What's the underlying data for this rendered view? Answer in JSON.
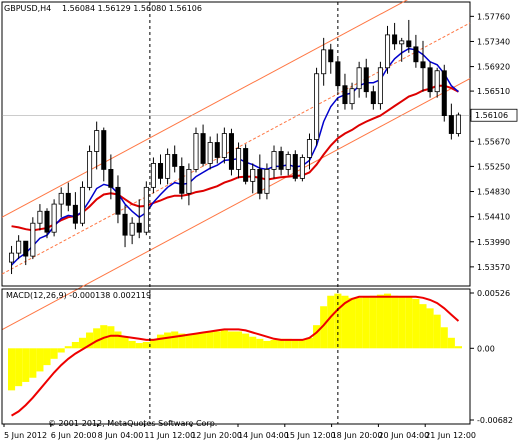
{
  "header": {
    "symbol": "GBPUSD,H4",
    "ohlc": "1.56084 1.56129 1.56080 1.56106"
  },
  "macd_header": "MACD(12,26,9) -0.000138 0.002119",
  "copyright": "© 2001-2012, MetaQuotes Software Corp.",
  "colors": {
    "bull_candle": "#ffffff",
    "bear_candle": "#000000",
    "fast_ma": "#0000cc",
    "slow_ma": "#dd0000",
    "channel": "#ff7744",
    "macd_hist": "#ffff00",
    "macd_signal": "#ee0000"
  },
  "chart_data": [
    {
      "type": "candlestick",
      "title": "GBPUSD,H4",
      "current_price": 1.56106,
      "y_ticks": [
        "1.57760",
        "1.57340",
        "1.56920",
        "1.56510",
        "1.56090",
        "1.55670",
        "1.55250",
        "1.54830",
        "1.54410",
        "1.53990",
        "1.53570"
      ],
      "ylim": [
        1.5325,
        1.58
      ],
      "x_labels": [
        "5 Jun 2012",
        "6 Jun 20:00",
        "8 Jun 04:00",
        "11 Jun 12:00",
        "12 Jun 20:00",
        "14 Jun 04:00",
        "15 Jun 12:00",
        "18 Jun 20:00",
        "20 Jun 04:00",
        "21 Jun 12:00"
      ],
      "candles": [
        [
          1.5365,
          1.5392,
          1.5345,
          1.538
        ],
        [
          1.538,
          1.541,
          1.537,
          1.54
        ],
        [
          1.54,
          1.5395,
          1.536,
          1.5375
        ],
        [
          1.5375,
          1.544,
          1.537,
          1.543
        ],
        [
          1.543,
          1.5462,
          1.5418,
          1.545
        ],
        [
          1.545,
          1.5455,
          1.5405,
          1.5415
        ],
        [
          1.5415,
          1.547,
          1.5408,
          1.5462
        ],
        [
          1.5462,
          1.549,
          1.544,
          1.548
        ],
        [
          1.548,
          1.5498,
          1.545,
          1.546
        ],
        [
          1.546,
          1.5482,
          1.542,
          1.543
        ],
        [
          1.543,
          1.55,
          1.5425,
          1.549
        ],
        [
          1.549,
          1.556,
          1.5485,
          1.555
        ],
        [
          1.555,
          1.56,
          1.552,
          1.5585
        ],
        [
          1.5585,
          1.559,
          1.55,
          1.552
        ],
        [
          1.552,
          1.5545,
          1.547,
          1.549
        ],
        [
          1.549,
          1.551,
          1.543,
          1.5445
        ],
        [
          1.5445,
          1.546,
          1.539,
          1.541
        ],
        [
          1.541,
          1.544,
          1.5395,
          1.543
        ],
        [
          1.543,
          1.547,
          1.5405,
          1.5415
        ],
        [
          1.5415,
          1.55,
          1.541,
          1.549
        ],
        [
          1.549,
          1.554,
          1.548,
          1.553
        ],
        [
          1.553,
          1.5545,
          1.5495,
          1.5505
        ],
        [
          1.5505,
          1.5555,
          1.5495,
          1.5545
        ],
        [
          1.5545,
          1.556,
          1.5515,
          1.5525
        ],
        [
          1.5525,
          1.554,
          1.547,
          1.548
        ],
        [
          1.548,
          1.553,
          1.546,
          1.552
        ],
        [
          1.552,
          1.559,
          1.5515,
          1.558
        ],
        [
          1.558,
          1.5595,
          1.5525,
          1.553
        ],
        [
          1.553,
          1.5575,
          1.552,
          1.5565
        ],
        [
          1.5565,
          1.558,
          1.553,
          1.554
        ],
        [
          1.554,
          1.559,
          1.553,
          1.558
        ],
        [
          1.558,
          1.5588,
          1.551,
          1.552
        ],
        [
          1.552,
          1.5565,
          1.5505,
          1.5555
        ],
        [
          1.5555,
          1.5562,
          1.5495,
          1.55
        ],
        [
          1.55,
          1.553,
          1.548,
          1.552
        ],
        [
          1.552,
          1.5545,
          1.547,
          1.548
        ],
        [
          1.548,
          1.553,
          1.547,
          1.552
        ],
        [
          1.552,
          1.556,
          1.5505,
          1.555
        ],
        [
          1.555,
          1.5558,
          1.551,
          1.552
        ],
        [
          1.552,
          1.555,
          1.551,
          1.5545
        ],
        [
          1.5545,
          1.5552,
          1.55,
          1.5505
        ],
        [
          1.5505,
          1.5545,
          1.55,
          1.554
        ],
        [
          1.554,
          1.558,
          1.552,
          1.557
        ],
        [
          1.557,
          1.569,
          1.556,
          1.568
        ],
        [
          1.568,
          1.574,
          1.566,
          1.572
        ],
        [
          1.572,
          1.573,
          1.568,
          1.57
        ],
        [
          1.57,
          1.5705,
          1.565,
          1.566
        ],
        [
          1.566,
          1.568,
          1.562,
          1.563
        ],
        [
          1.563,
          1.5665,
          1.562,
          1.5655
        ],
        [
          1.5655,
          1.57,
          1.564,
          1.569
        ],
        [
          1.569,
          1.5705,
          1.564,
          1.565
        ],
        [
          1.565,
          1.566,
          1.562,
          1.563
        ],
        [
          1.563,
          1.57,
          1.562,
          1.569
        ],
        [
          1.569,
          1.576,
          1.568,
          1.5745
        ],
        [
          1.5745,
          1.5765,
          1.572,
          1.573
        ],
        [
          1.573,
          1.574,
          1.57,
          1.5735
        ],
        [
          1.5735,
          1.577,
          1.5715,
          1.5725
        ],
        [
          1.5725,
          1.5745,
          1.569,
          1.57
        ],
        [
          1.57,
          1.5735,
          1.565,
          1.569
        ],
        [
          1.569,
          1.57,
          1.564,
          1.565
        ],
        [
          1.565,
          1.569,
          1.564,
          1.5685
        ],
        [
          1.5685,
          1.5695,
          1.56,
          1.561
        ],
        [
          1.561,
          1.563,
          1.557,
          1.558
        ],
        [
          1.558,
          1.5615,
          1.5575,
          1.5611
        ]
      ],
      "fast_ma": [
        1.536,
        1.5372,
        1.538,
        1.5392,
        1.5405,
        1.541,
        1.5425,
        1.5438,
        1.5443,
        1.5441,
        1.545,
        1.5468,
        1.5488,
        1.5495,
        1.5492,
        1.548,
        1.5462,
        1.545,
        1.544,
        1.5448,
        1.5465,
        1.5478,
        1.549,
        1.5498,
        1.5495,
        1.5497,
        1.5508,
        1.5515,
        1.5522,
        1.5527,
        1.5535,
        1.5536,
        1.5538,
        1.5532,
        1.5528,
        1.5522,
        1.552,
        1.5525,
        1.5525,
        1.5528,
        1.5524,
        1.5526,
        1.5535,
        1.556,
        1.56,
        1.5625,
        1.564,
        1.5645,
        1.5648,
        1.566,
        1.5665,
        1.5665,
        1.567,
        1.569,
        1.5705,
        1.5715,
        1.5722,
        1.572,
        1.5712,
        1.57,
        1.5695,
        1.568,
        1.566,
        1.565
      ],
      "slow_ma": [
        1.5425,
        1.5423,
        1.542,
        1.5418,
        1.542,
        1.5422,
        1.5428,
        1.5435,
        1.544,
        1.5442,
        1.5448,
        1.5458,
        1.547,
        1.5478,
        1.548,
        1.5478,
        1.547,
        1.5462,
        1.5458,
        1.5459,
        1.5464,
        1.5468,
        1.5473,
        1.5476,
        1.5476,
        1.5478,
        1.5482,
        1.5484,
        1.5488,
        1.5492,
        1.5498,
        1.5502,
        1.5507,
        1.5508,
        1.5508,
        1.5506,
        1.5503,
        1.5505,
        1.5507,
        1.5508,
        1.5509,
        1.551,
        1.5515,
        1.5528,
        1.5545,
        1.556,
        1.5572,
        1.558,
        1.5586,
        1.5594,
        1.56,
        1.5605,
        1.561,
        1.5618,
        1.5626,
        1.5634,
        1.5642,
        1.5646,
        1.5652,
        1.5655,
        1.566,
        1.566,
        1.5656,
        1.565
      ]
    },
    {
      "type": "histogram",
      "title": "MACD(12,26,9) -0.000138 0.002119",
      "y_ticks": [
        "0.00526",
        "0.00",
        "-0.00682"
      ],
      "ylim": [
        -0.00682,
        0.00526
      ],
      "histogram": [
        -0.004,
        -0.0036,
        -0.0032,
        -0.0028,
        -0.0022,
        -0.0016,
        -0.001,
        -0.0004,
        0.0002,
        0.0006,
        0.001,
        0.0015,
        0.0019,
        0.0022,
        0.0021,
        0.0016,
        0.0011,
        0.0007,
        0.0005,
        0.0006,
        0.0009,
        0.0013,
        0.0015,
        0.0016,
        0.0014,
        0.0013,
        0.0014,
        0.0015,
        0.0016,
        0.0016,
        0.0017,
        0.0016,
        0.0016,
        0.0014,
        0.0011,
        0.0009,
        0.0007,
        0.0008,
        0.0009,
        0.0009,
        0.0008,
        0.0008,
        0.001,
        0.0022,
        0.004,
        0.005,
        0.0052,
        0.005,
        0.0048,
        0.0048,
        0.0049,
        0.005,
        0.0051,
        0.0052,
        0.005,
        0.0049,
        0.0049,
        0.0047,
        0.0042,
        0.0038,
        0.0032,
        0.002,
        0.001,
        0.0002
      ],
      "signal": [
        -0.0064,
        -0.006,
        -0.0054,
        -0.0047,
        -0.0039,
        -0.0031,
        -0.0023,
        -0.0016,
        -0.001,
        -0.0005,
        -0.0001,
        0.0003,
        0.0007,
        0.001,
        0.0012,
        0.0012,
        0.0011,
        0.001,
        0.0009,
        0.0008,
        0.0008,
        0.0009,
        0.001,
        0.0011,
        0.0012,
        0.0013,
        0.0014,
        0.0015,
        0.0016,
        0.0017,
        0.0018,
        0.0018,
        0.0018,
        0.0017,
        0.0015,
        0.0013,
        0.0011,
        0.0009,
        0.0008,
        0.0008,
        0.0008,
        0.0008,
        0.001,
        0.0015,
        0.0022,
        0.003,
        0.0037,
        0.0043,
        0.0047,
        0.0049,
        0.0049,
        0.0049,
        0.0049,
        0.0049,
        0.0049,
        0.0049,
        0.0049,
        0.0049,
        0.0048,
        0.0046,
        0.0043,
        0.0038,
        0.0032,
        0.0026
      ]
    }
  ]
}
